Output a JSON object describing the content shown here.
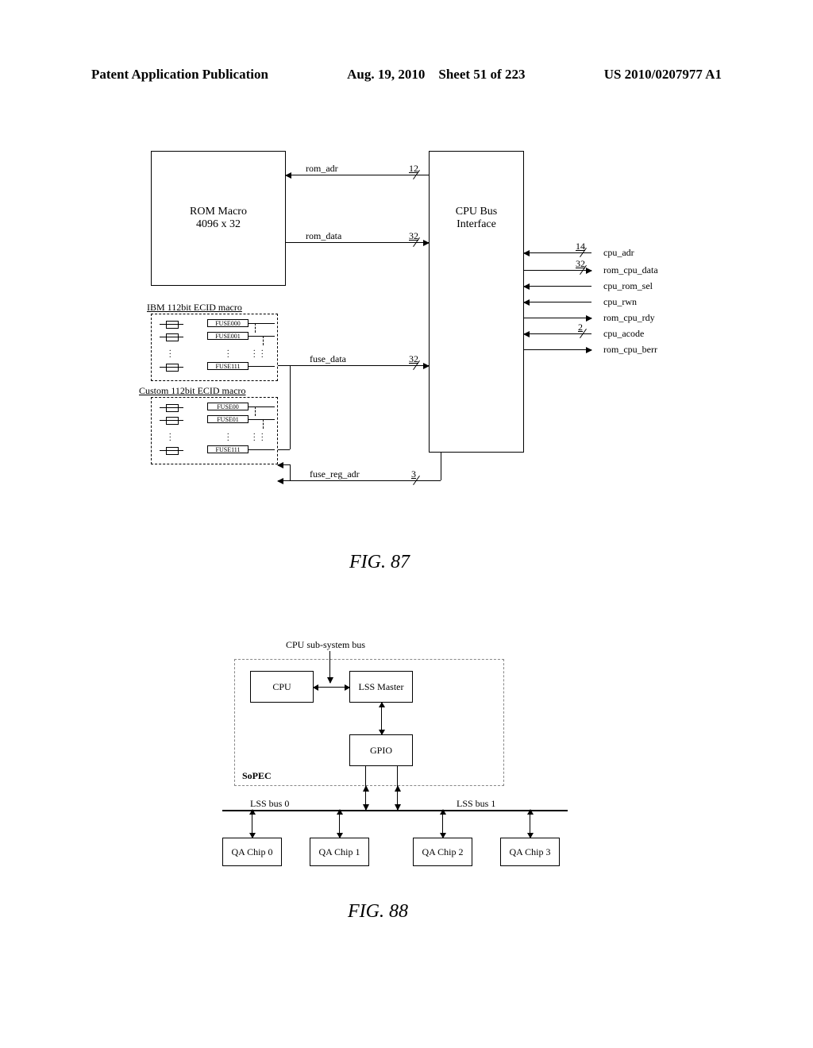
{
  "header": {
    "left": "Patent Application Publication",
    "date": "Aug. 19, 2010",
    "sheet": "Sheet 51 of 223",
    "pubno": "US 2010/0207977 A1"
  },
  "fig87": {
    "rom_macro": {
      "line1": "ROM Macro",
      "line2": "4096 x 32"
    },
    "cpu_bus": {
      "line1": "CPU Bus",
      "line2": "Interface"
    },
    "signals_top": {
      "rom_adr": {
        "name": "rom_adr",
        "width": "12"
      },
      "rom_data": {
        "name": "rom_data",
        "width": "32"
      }
    },
    "signals_right": {
      "cpu_adr": {
        "name": "cpu_adr",
        "width": "14"
      },
      "rom_cpu_data": {
        "name": "rom_cpu_data",
        "width": "32"
      },
      "cpu_rom_sel": "cpu_rom_sel",
      "cpu_rwn": "cpu_rwn",
      "rom_cpu_rdy": "rom_cpu_rdy",
      "cpu_acode": {
        "name": "cpu_acode",
        "width": "2"
      },
      "rom_cpu_berr": "rom_cpu_berr"
    },
    "ecid_ibm": {
      "title": "IBM 112bit ECID macro",
      "fuses": [
        "FUSE000",
        "FUSE001",
        "FUSE111"
      ]
    },
    "ecid_custom": {
      "title": "Custom 112bit ECID macro",
      "fuses": [
        "FUSE00",
        "FUSE01",
        "FUSE111"
      ]
    },
    "fuse_data": {
      "name": "fuse_data",
      "width": "32"
    },
    "fuse_reg_adr": {
      "name": "fuse_reg_adr",
      "width": "3"
    },
    "caption": "FIG. 87"
  },
  "fig88": {
    "sopec_label": "SoPEC",
    "cpu": "CPU",
    "lss_master": "LSS Master",
    "gpio": "GPIO",
    "cpu_bus_label": "CPU sub-system bus",
    "lss_bus0": "LSS bus 0",
    "lss_bus1": "LSS bus 1",
    "qa": [
      "QA Chip 0",
      "QA Chip 1",
      "QA Chip 2",
      "QA Chip 3"
    ],
    "caption": "FIG. 88"
  }
}
